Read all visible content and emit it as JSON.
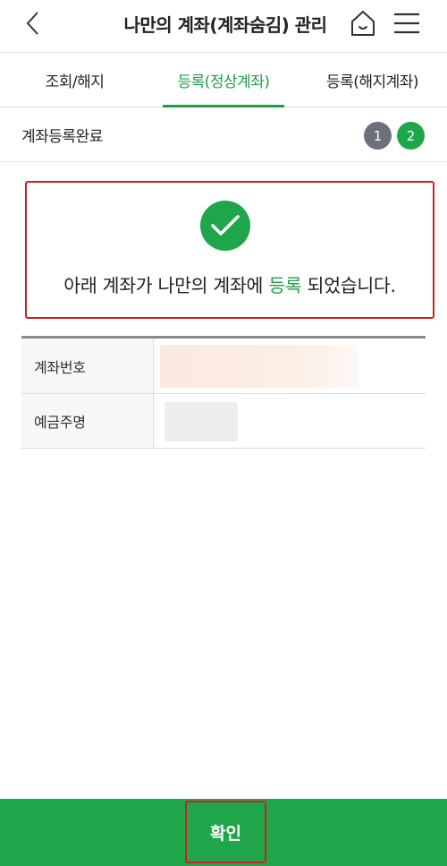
{
  "header": {
    "title": "나만의 계좌(계좌숨김) 관리",
    "back_icon": "chevron-left-icon",
    "home_icon": "home-icon",
    "menu_icon": "hamburger-menu-icon"
  },
  "tabs": [
    {
      "label": "조회/해지",
      "active": false
    },
    {
      "label": "등록(정상계좌)",
      "active": true
    },
    {
      "label": "등록(해지계좌)",
      "active": false
    }
  ],
  "step": {
    "title": "계좌등록완료",
    "steps": [
      "1",
      "2"
    ],
    "current": 2
  },
  "result": {
    "icon": "check-circle-icon",
    "message_prefix": "아래 계좌가 나만의 계좌에 ",
    "message_highlight": "등록",
    "message_suffix": " 되었습니다."
  },
  "info": {
    "account_number_label": "계좌번호",
    "depositor_label": "예금주명"
  },
  "footer": {
    "confirm_label": "확인"
  },
  "colors": {
    "accent_green": "#1fa64a",
    "highlight_red": "#d11e26",
    "step_gray": "#6b7079"
  }
}
